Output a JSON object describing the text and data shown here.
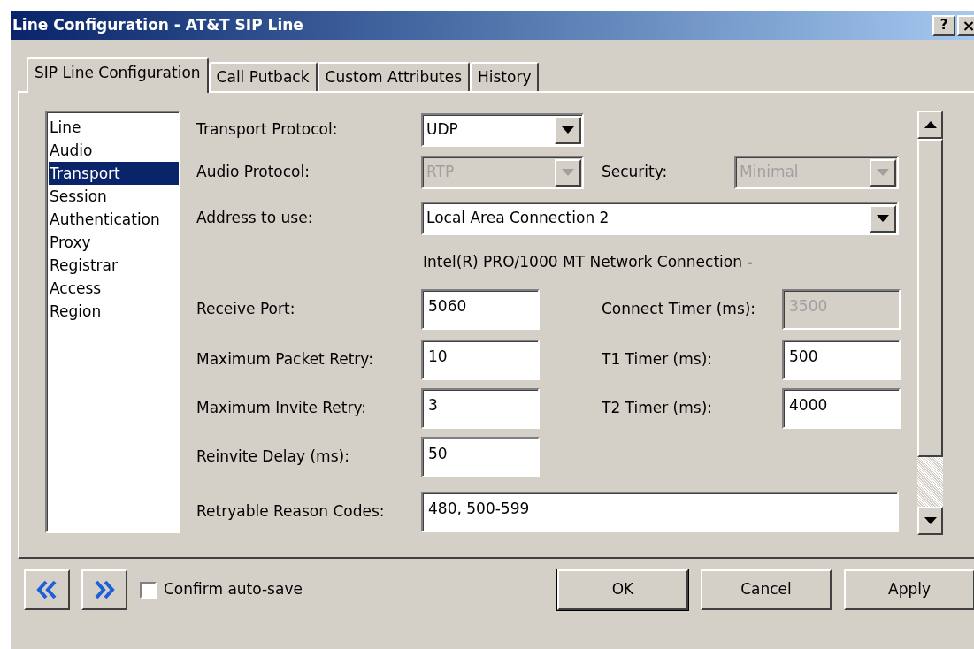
{
  "window": {
    "title": "Line Configuration - AT&T SIP Line",
    "help": "?",
    "close": "×"
  },
  "tabs": [
    {
      "label": "SIP Line Configuration",
      "selected": true
    },
    {
      "label": "Call Putback",
      "selected": false
    },
    {
      "label": "Custom Attributes",
      "selected": false
    },
    {
      "label": "History",
      "selected": false
    }
  ],
  "sections": [
    {
      "label": "Line",
      "selected": false
    },
    {
      "label": "Audio",
      "selected": false
    },
    {
      "label": "Transport",
      "selected": true
    },
    {
      "label": "Session",
      "selected": false
    },
    {
      "label": "Authentication",
      "selected": false
    },
    {
      "label": "Proxy",
      "selected": false
    },
    {
      "label": "Registrar",
      "selected": false
    },
    {
      "label": "Access",
      "selected": false
    },
    {
      "label": "Region",
      "selected": false
    }
  ],
  "transport_protocol": {
    "label": "Transport Protocol:",
    "value": "UDP",
    "disabled": false
  },
  "audio_protocol": {
    "label": "Audio Protocol:",
    "value": "RTP",
    "disabled": true
  },
  "security": {
    "label": "Security:",
    "value": "Minimal",
    "disabled": true
  },
  "address": {
    "label": "Address to use:",
    "value": "Local Area Connection 2",
    "disabled": false
  },
  "address_note": "Intel(R) PRO/1000 MT Network Connection -",
  "receive_port": {
    "label": "Receive Port:",
    "value": "5060",
    "disabled": false
  },
  "connect_timer": {
    "label": "Connect Timer (ms):",
    "value": "3500",
    "disabled": true
  },
  "max_packet_retry": {
    "label": "Maximum Packet Retry:",
    "value": "10",
    "disabled": false
  },
  "t1_timer": {
    "label": "T1 Timer (ms):",
    "value": "500",
    "disabled": false
  },
  "max_invite_retry": {
    "label": "Maximum Invite Retry:",
    "value": "3",
    "disabled": false
  },
  "t2_timer": {
    "label": "T2 Timer (ms):",
    "value": "4000",
    "disabled": false
  },
  "reinvite_delay": {
    "label": "Reinvite Delay (ms):",
    "value": "50",
    "disabled": false
  },
  "reason_codes": {
    "label": "Retryable Reason Codes:",
    "value": "480, 500-599",
    "disabled": false
  },
  "confirm_autosave": {
    "label": "Confirm auto-save",
    "checked": false
  },
  "buttons": [
    {
      "label": "OK",
      "default": true
    },
    {
      "label": "Cancel",
      "default": false
    },
    {
      "label": "Apply",
      "default": false
    }
  ]
}
